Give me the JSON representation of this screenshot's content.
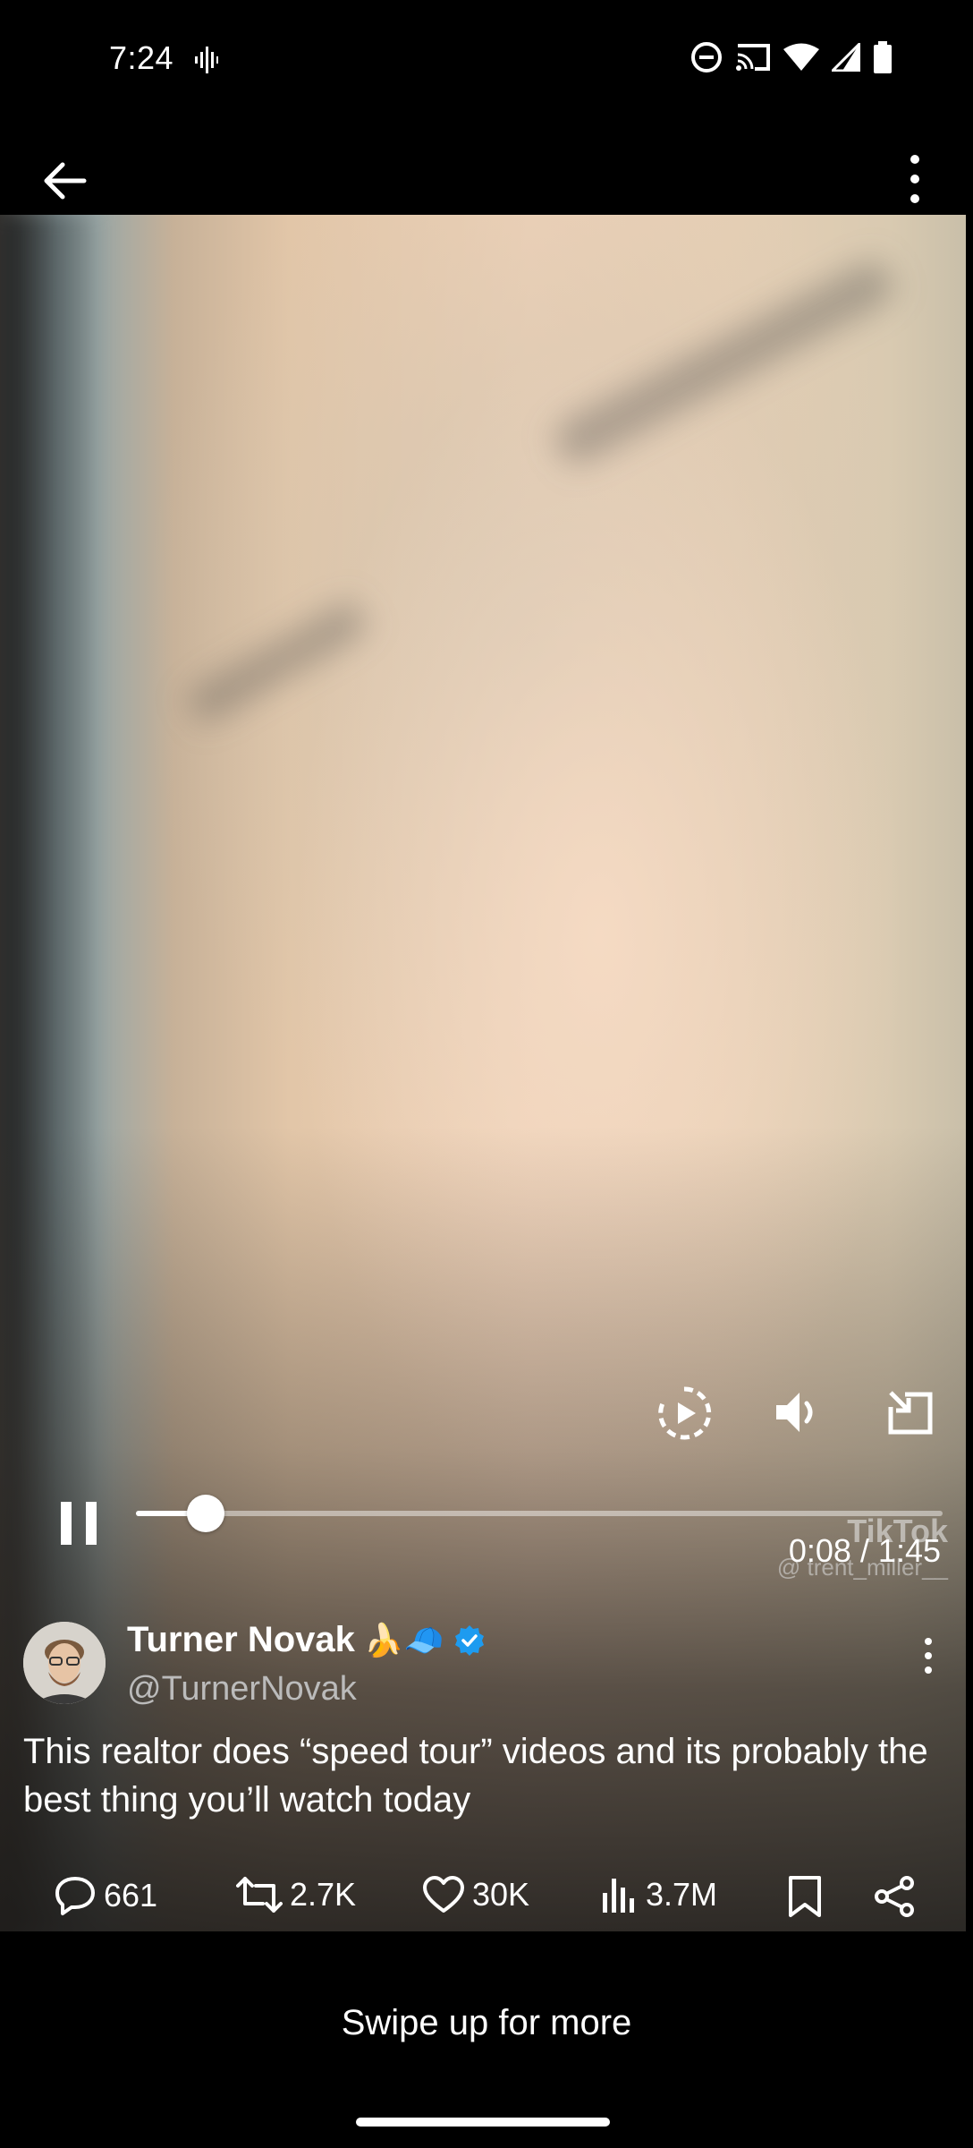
{
  "status_bar": {
    "time": "7:24",
    "icons": [
      "voice-wave-icon",
      "do-not-disturb-icon",
      "cast-icon",
      "wifi-icon",
      "signal-icon",
      "battery-icon"
    ]
  },
  "top_bar": {
    "back_icon": "arrow-left-icon",
    "more_icon": "more-vertical-icon"
  },
  "video": {
    "controls": [
      "replay-icon",
      "volume-icon",
      "minimize-icon"
    ],
    "progress_fraction": 0.087,
    "current_time": "0:08",
    "duration": "1:45",
    "time_display": "0:08 / 1:45",
    "watermark": {
      "logo": "TikTok",
      "user": "@ trent_miller__"
    }
  },
  "tweet": {
    "author_name": "Turner Novak",
    "author_emojis": "🍌🧢",
    "verified": true,
    "handle": "@TurnerNovak",
    "text": "This realtor does “speed tour” videos and its probably the best thing you’ll watch today"
  },
  "actions": {
    "replies": "661",
    "reposts": "2.7K",
    "likes": "30K",
    "views": "3.7M"
  },
  "footer": {
    "swipe_text": "Swipe up for more"
  },
  "colors": {
    "background": "#000000",
    "verified": "#1d9bf0",
    "text": "#ffffff"
  }
}
